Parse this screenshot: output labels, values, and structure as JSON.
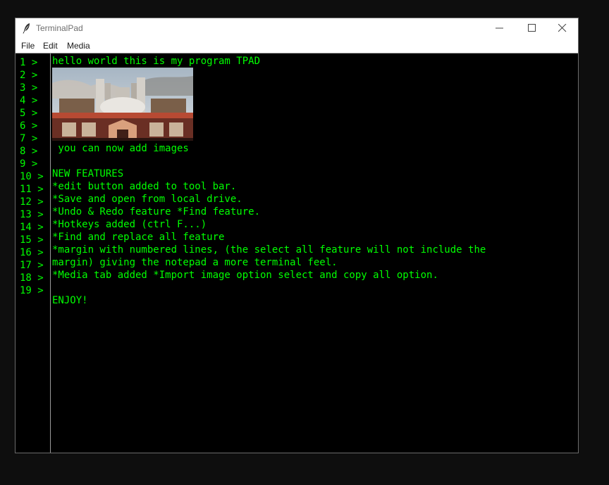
{
  "window": {
    "title": "TerminalPad",
    "app_icon": "quill-feather-icon"
  },
  "titlebar_buttons": [
    "minimize-icon",
    "maximize-icon",
    "close-icon"
  ],
  "menu": [
    "File",
    "Edit",
    "Media"
  ],
  "gutter": [
    "1 >",
    "2 >",
    "3 >",
    "4 >",
    "5 >",
    "6 >",
    "7 >",
    "8 >",
    "9 >",
    "10 >",
    "11 >",
    "12 >",
    "13 >",
    "14 >",
    "15 >",
    "16 >",
    "17 >",
    "18 >",
    "19 >"
  ],
  "editor": {
    "lines": [
      "hello world this is my program TPAD",
      " you can now add images",
      "NEW FEATURES",
      "*edit button added to tool bar.",
      "*Save and open from local drive.",
      "*Undo & Redo feature *Find feature.",
      "*Hotkeys added (ctrl F...)",
      "*Find and replace all feature",
      "*margin with numbered lines, (the select all feature will not include the",
      "margin) giving the notepad a more terminal feel.",
      "*Media tab added *Import image option select and copy all option.",
      "ENJOY!"
    ]
  },
  "colors": {
    "text": "#00ff00",
    "background": "#000000"
  }
}
